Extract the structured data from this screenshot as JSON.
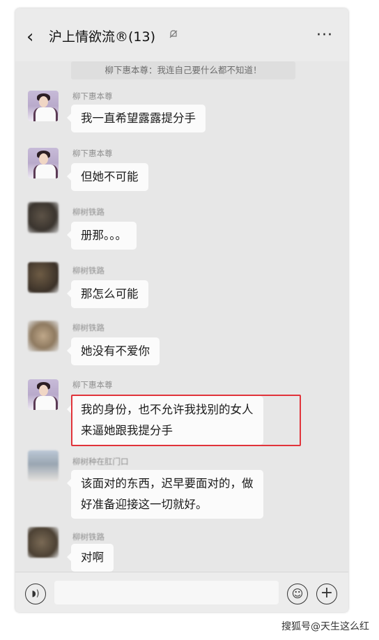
{
  "header": {
    "back_icon": "chevron-left-icon",
    "title": "沪上情欲流®(13)",
    "mute_icon": "bell-muted-icon",
    "more_label": "···"
  },
  "pinned_notice": "柳下惠本尊：我连自己要什么都不知道！",
  "messages": [
    {
      "sender": "柳下惠本尊",
      "text": "我一直希望露露提分手"
    },
    {
      "sender": "柳下惠本尊",
      "text": "但她不可能"
    },
    {
      "sender": "柳树铁路",
      "text": "册那。。。"
    },
    {
      "sender": "柳树铁路",
      "text": "那怎么可能"
    },
    {
      "sender": "柳树铁路",
      "text": "她没有不爱你"
    },
    {
      "sender": "柳下惠本尊",
      "text": "我的身份，也不允许我找别的女人\n来逼她跟我提分手"
    },
    {
      "sender": "柳树种在肛门口",
      "text": "该面对的东西，迟早要面对的，做\n好准备迎接这一切就好。"
    },
    {
      "sender": "柳树铁路",
      "text": "对啊"
    }
  ],
  "input_bar": {
    "voice_icon": "voice-icon",
    "emoji_icon": "emoji-icon",
    "plus_icon": "plus-icon",
    "voice_glyph": "◗)",
    "emoji_glyph": "☺",
    "plus_glyph": "+"
  },
  "watermark": "搜狐号@天生这么红",
  "colors": {
    "highlight_border": "#e1333a",
    "chat_background": "#e7e7e7",
    "bubble": "#fbfbfb"
  }
}
